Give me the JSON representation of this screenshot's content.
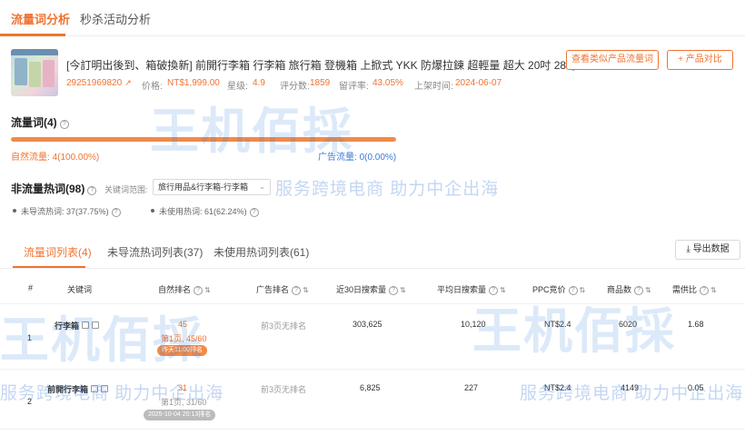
{
  "top_tabs": [
    {
      "label": "流量词分析",
      "active": true
    },
    {
      "label": "秒杀活动分析",
      "active": false
    }
  ],
  "product": {
    "title": "[今訂明出後到、箱破換新] 前開行李箱 行李箱 旅行箱 登機箱 上掀式 YKK 防爆拉鍊 超輕量 超大 20吋 28吋",
    "id": "29251969820",
    "price_label": "价格:",
    "price": "NT$1,999.00",
    "stars_label": "星级:",
    "stars": "4.9",
    "reviews_label": "评分数:",
    "reviews": "1859",
    "rating_rate_label": "留评率:",
    "rating_rate": "43.05%",
    "listed_label": "上架时间:",
    "listed": "2024-06-07"
  },
  "actions": {
    "similar_traffic": "查看类似产品流量词",
    "compare": "+ 产品对比"
  },
  "traffic_words": {
    "title": "流量词(4)",
    "organic_label": "自然流量:",
    "organic_value": "4(100.00%)",
    "ad_label": "广告流量:",
    "ad_value": "0(0.00%)",
    "organic_share": 1.0
  },
  "non_traffic": {
    "title": "非流量热词(98)",
    "scope_label": "关键词范围:",
    "scope_value": "旅行用品&行李箱-行李箱",
    "unguided_label": "未导流热词:",
    "unguided_value": "37(37.75%)",
    "unused_label": "未使用热词:",
    "unused_value": "61(62.24%)"
  },
  "sub_tabs": [
    {
      "label": "流量词列表(4)",
      "active": true
    },
    {
      "label": "未导流热词列表(37)",
      "active": false
    },
    {
      "label": "未使用热词列表(61)",
      "active": false
    }
  ],
  "export_label": "导出数据",
  "columns": [
    "#",
    "关键词",
    "自然排名",
    "广告排名",
    "近30日搜索量",
    "平均日搜索量",
    "PPC竞价",
    "商品数",
    "需供比"
  ],
  "rows": [
    {
      "index": "1",
      "keyword": "行李箱",
      "natural_rank": "45",
      "natural_page": "第1页, 45/60",
      "natural_badge": "昨天11:00排名",
      "ad_rank": "前3页无排名",
      "search_30d": "303,625",
      "avg_daily": "10,120",
      "ppc": "NT$2.4",
      "products": "6020",
      "ratio": "1.68"
    },
    {
      "index": "2",
      "keyword": "前開行李箱",
      "natural_rank": "31",
      "natural_page": "第1页, 31/60",
      "natural_badge": "2025-10-04 20:13排名",
      "ad_rank": "前3页无排名",
      "search_30d": "6,825",
      "avg_daily": "227",
      "ppc": "NT$2.4",
      "products": "4149",
      "ratio": "0.05"
    }
  ],
  "watermark": {
    "brand": "王机佰採",
    "slogan": "服务跨境电商 助力中企出海"
  }
}
